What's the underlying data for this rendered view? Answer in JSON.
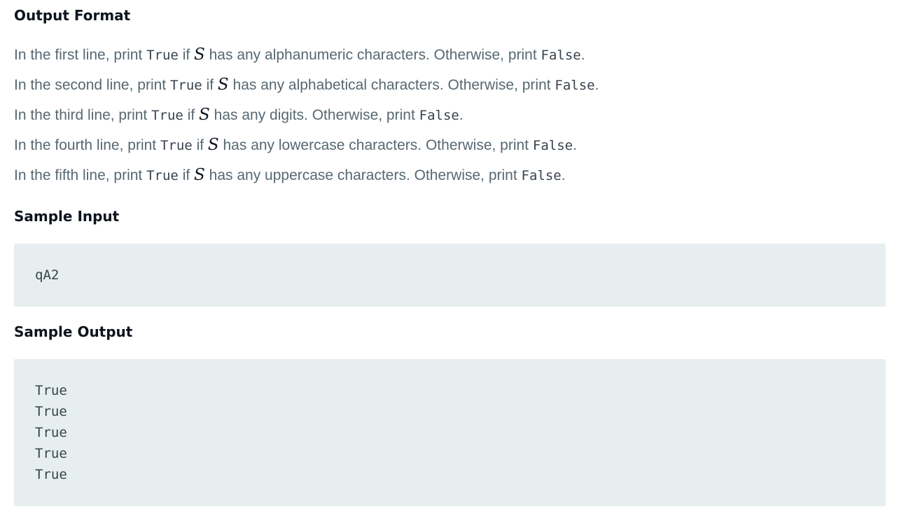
{
  "headings": {
    "output_format": "Output Format",
    "sample_input": "Sample Input",
    "sample_output": "Sample Output"
  },
  "variable": "S",
  "lines": [
    {
      "prefix": "In the first line, print ",
      "true": "True",
      "if": " if ",
      "suffix": " has any alphanumeric characters. Otherwise, print ",
      "false": "False",
      "end": "."
    },
    {
      "prefix": "In the second line, print ",
      "true": "True",
      "if": " if ",
      "suffix": " has any alphabetical characters. Otherwise, print ",
      "false": "False",
      "end": "."
    },
    {
      "prefix": "In the third line, print ",
      "true": "True",
      "if": " if ",
      "suffix": " has any digits. Otherwise, print ",
      "false": "False",
      "end": "."
    },
    {
      "prefix": "In the fourth line, print ",
      "true": "True",
      "if": " if ",
      "suffix": " has any lowercase characters. Otherwise, print ",
      "false": "False",
      "end": "."
    },
    {
      "prefix": "In the fifth line, print ",
      "true": "True",
      "if": " if ",
      "suffix": " has any uppercase characters. Otherwise, print ",
      "false": "False",
      "end": "."
    }
  ],
  "sample_input": "qA2",
  "sample_output": [
    "True",
    "True",
    "True",
    "True",
    "True"
  ]
}
